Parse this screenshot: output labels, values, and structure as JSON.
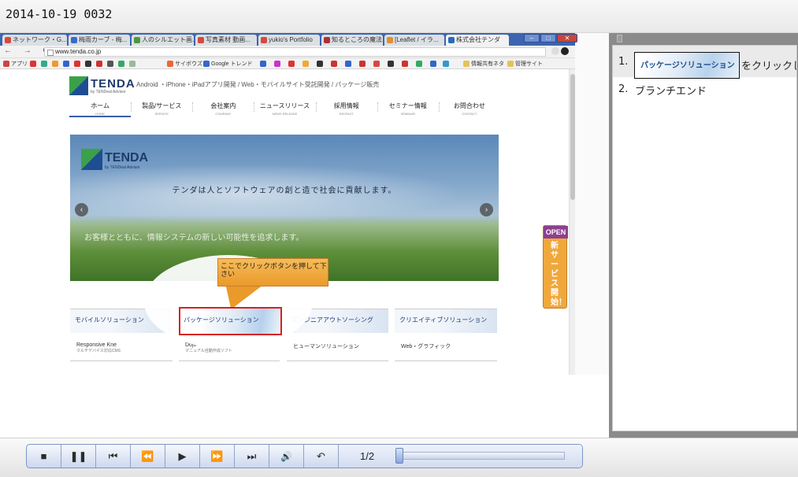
{
  "title_bar": {
    "text": "2014-10-19 0032"
  },
  "browser": {
    "tabs": [
      {
        "label": "ネットワーク・G...",
        "color": "#d64a3a"
      },
      {
        "label": "梅雨カーブ - 梅...",
        "color": "#3a6bc8"
      },
      {
        "label": "人のシルエット画...",
        "color": "#4a9a3a"
      },
      {
        "label": "写真素材 動画...",
        "color": "#d64a3a"
      },
      {
        "label": "yukio's Portfolio",
        "color": "#d64a3a"
      },
      {
        "label": "知るところの魔法...",
        "color": "#b03030"
      },
      {
        "label": "[Leaflet / イラ...",
        "color": "#e09030"
      },
      {
        "label": "株式会社テンダ",
        "color": "#2a6ab8"
      }
    ],
    "nav_glyphs": "← → C",
    "url": "www.tenda.co.jp",
    "bookmarks": [
      "アプリ",
      "サイボウズ",
      "Google トレンド",
      "情報共有ネタ",
      "管理サイト"
    ]
  },
  "site": {
    "logo": "TENDA",
    "logo_sub": "by TENDeal Advisor",
    "tagline": "Android ・iPhone・iPadアプリ開発 / Web・モバイルサイト受託開発 / パッケージ販売",
    "nav": [
      {
        "label": "ホーム",
        "en": "HOME"
      },
      {
        "label": "製品/サービス",
        "en": "SERVICE"
      },
      {
        "label": "会社案内",
        "en": "COMPANY"
      },
      {
        "label": "ニュースリリース",
        "en": "NEWS RELEASE"
      },
      {
        "label": "採用情報",
        "en": "RECRUIT"
      },
      {
        "label": "セミナー情報",
        "en": "SEMINAR"
      },
      {
        "label": "お問合わせ",
        "en": "CONTACT"
      }
    ],
    "banner": {
      "logo": "TENDA",
      "logo_sub": "by TENDeal Advisor",
      "copy1": "テンダは人とソフトウェアの創と造で社会に貢献します。",
      "copy2": "お客様とともに、情報システムの新しい可能性を追求します。",
      "prev": "‹",
      "next": "›"
    },
    "open_badge": {
      "label": "OPEN",
      "text": "新サービス開始！"
    },
    "solutions": [
      {
        "head": "モバイルソリューション",
        "item": "Responsive Kne",
        "sub": "マルチデバイス対応CMS"
      },
      {
        "head": "パッケージソリューション",
        "item": "Dojo",
        "sub": "マニュアル自動作成ソフト"
      },
      {
        "head": "エンジニアアウトソーシング",
        "item": "ヒューマンソリューション",
        "sub": ""
      },
      {
        "head": "クリエイティブソリューション",
        "item": "Web・グラフィック",
        "sub": ""
      }
    ],
    "callout": "ここでクリックボタンを押して下さい"
  },
  "sidebar": {
    "steps": [
      {
        "num": "1.",
        "thumb": "パッケージソリューション",
        "text": "をクリックし"
      },
      {
        "num": "2.",
        "text": "ブランチエンド"
      }
    ]
  },
  "controls": {
    "buttons": [
      "■",
      "❚❚",
      "⏮",
      "⏪",
      "▶",
      "⏩",
      "⏭",
      "🔊",
      "↶"
    ],
    "button_names": [
      "stop-icon",
      "pause-icon",
      "skip-start-icon",
      "rewind-icon",
      "play-icon",
      "fast-forward-icon",
      "skip-end-icon",
      "volume-icon",
      "undo-icon"
    ],
    "page": "1/2",
    "progress": 0
  }
}
